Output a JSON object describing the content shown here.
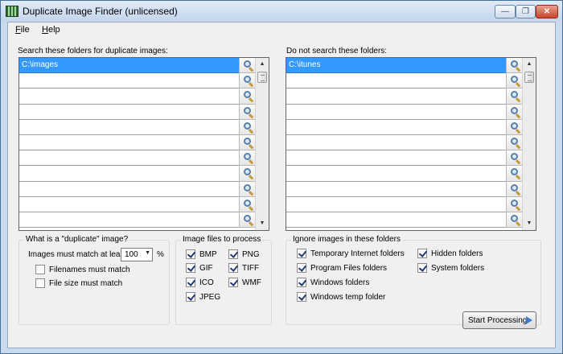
{
  "window": {
    "title": "Duplicate Image Finder (unlicensed)",
    "minimize": "—",
    "maximize": "❐",
    "close": "✕"
  },
  "menu": {
    "file_first": "F",
    "file_rest": "ile",
    "help_first": "H",
    "help_rest": "elp"
  },
  "search_folders": {
    "label": "Search these folders for duplicate images:",
    "items": [
      "C:\\images",
      "",
      "",
      "",
      "",
      "",
      "",
      "",
      "",
      "",
      ""
    ]
  },
  "exclude_folders": {
    "label": "Do not search these folders:",
    "items": [
      "C:\\itunes",
      "",
      "",
      "",
      "",
      "",
      "",
      "",
      "",
      "",
      ""
    ]
  },
  "duplicate_group": {
    "title": "What is a \"duplicate\" image?",
    "match_label": "Images must match at least",
    "match_value": "100",
    "percent": "%",
    "filenames_match": "Filenames must match",
    "filesize_match": "File size must match"
  },
  "image_files": {
    "title": "Image files to process",
    "bmp": "BMP",
    "gif": "GIF",
    "ico": "ICO",
    "jpeg": "JPEG",
    "png": "PNG",
    "tiff": "TIFF",
    "wmf": "WMF"
  },
  "ignore_group": {
    "title": "Ignore images in these folders",
    "temp_internet": "Temporary Internet folders",
    "program_files": "Program Files folders",
    "windows": "Windows folders",
    "windows_temp": "Windows temp folder",
    "hidden": "Hidden folders",
    "system": "System folders"
  },
  "actions": {
    "start": "Start Processing"
  },
  "icons": {
    "app": "app-grid-icon",
    "browse": "magnifier-icon",
    "start": "play-arrow-icon"
  },
  "colors": {
    "selection": "#3399ff",
    "title_bar": "#c9dbee",
    "close_button": "#c9442a",
    "checkmark": "#233a73"
  }
}
